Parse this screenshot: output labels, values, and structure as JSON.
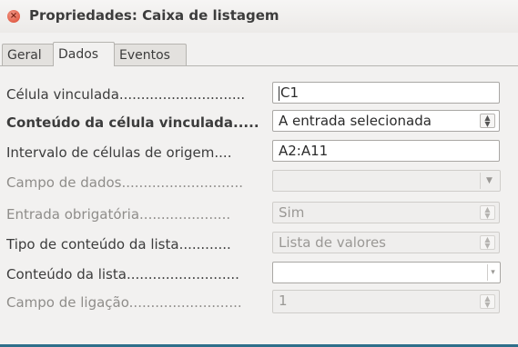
{
  "window": {
    "title": "Propriedades: Caixa de listagem",
    "close_icon": "×"
  },
  "tabs": [
    {
      "label": "Geral",
      "active": false
    },
    {
      "label": "Dados",
      "active": true
    },
    {
      "label": "Eventos",
      "active": false
    }
  ],
  "fields": {
    "linked_cell": {
      "label": "Célula vinculada.............................",
      "value": "C1"
    },
    "linked_cell_content": {
      "label": "Conteúdo da célula vinculada.....",
      "value": "A entrada selecionada"
    },
    "source_range": {
      "label": "Intervalo de células de origem....",
      "value": "A2:A11"
    },
    "data_field": {
      "label": "Campo de dados............................",
      "value": ""
    },
    "input_required": {
      "label": "Entrada obrigatória.....................",
      "value": "Sim"
    },
    "list_content_type": {
      "label": "Tipo de conteúdo da lista............",
      "value": "Lista de valores"
    },
    "list_content": {
      "label": "Conteúdo da lista..........................",
      "value": ""
    },
    "bound_field": {
      "label": "Campo de ligação..........................",
      "value": "1"
    }
  },
  "icons": {
    "spin": "▲\n▼",
    "dropdown": "▼"
  }
}
